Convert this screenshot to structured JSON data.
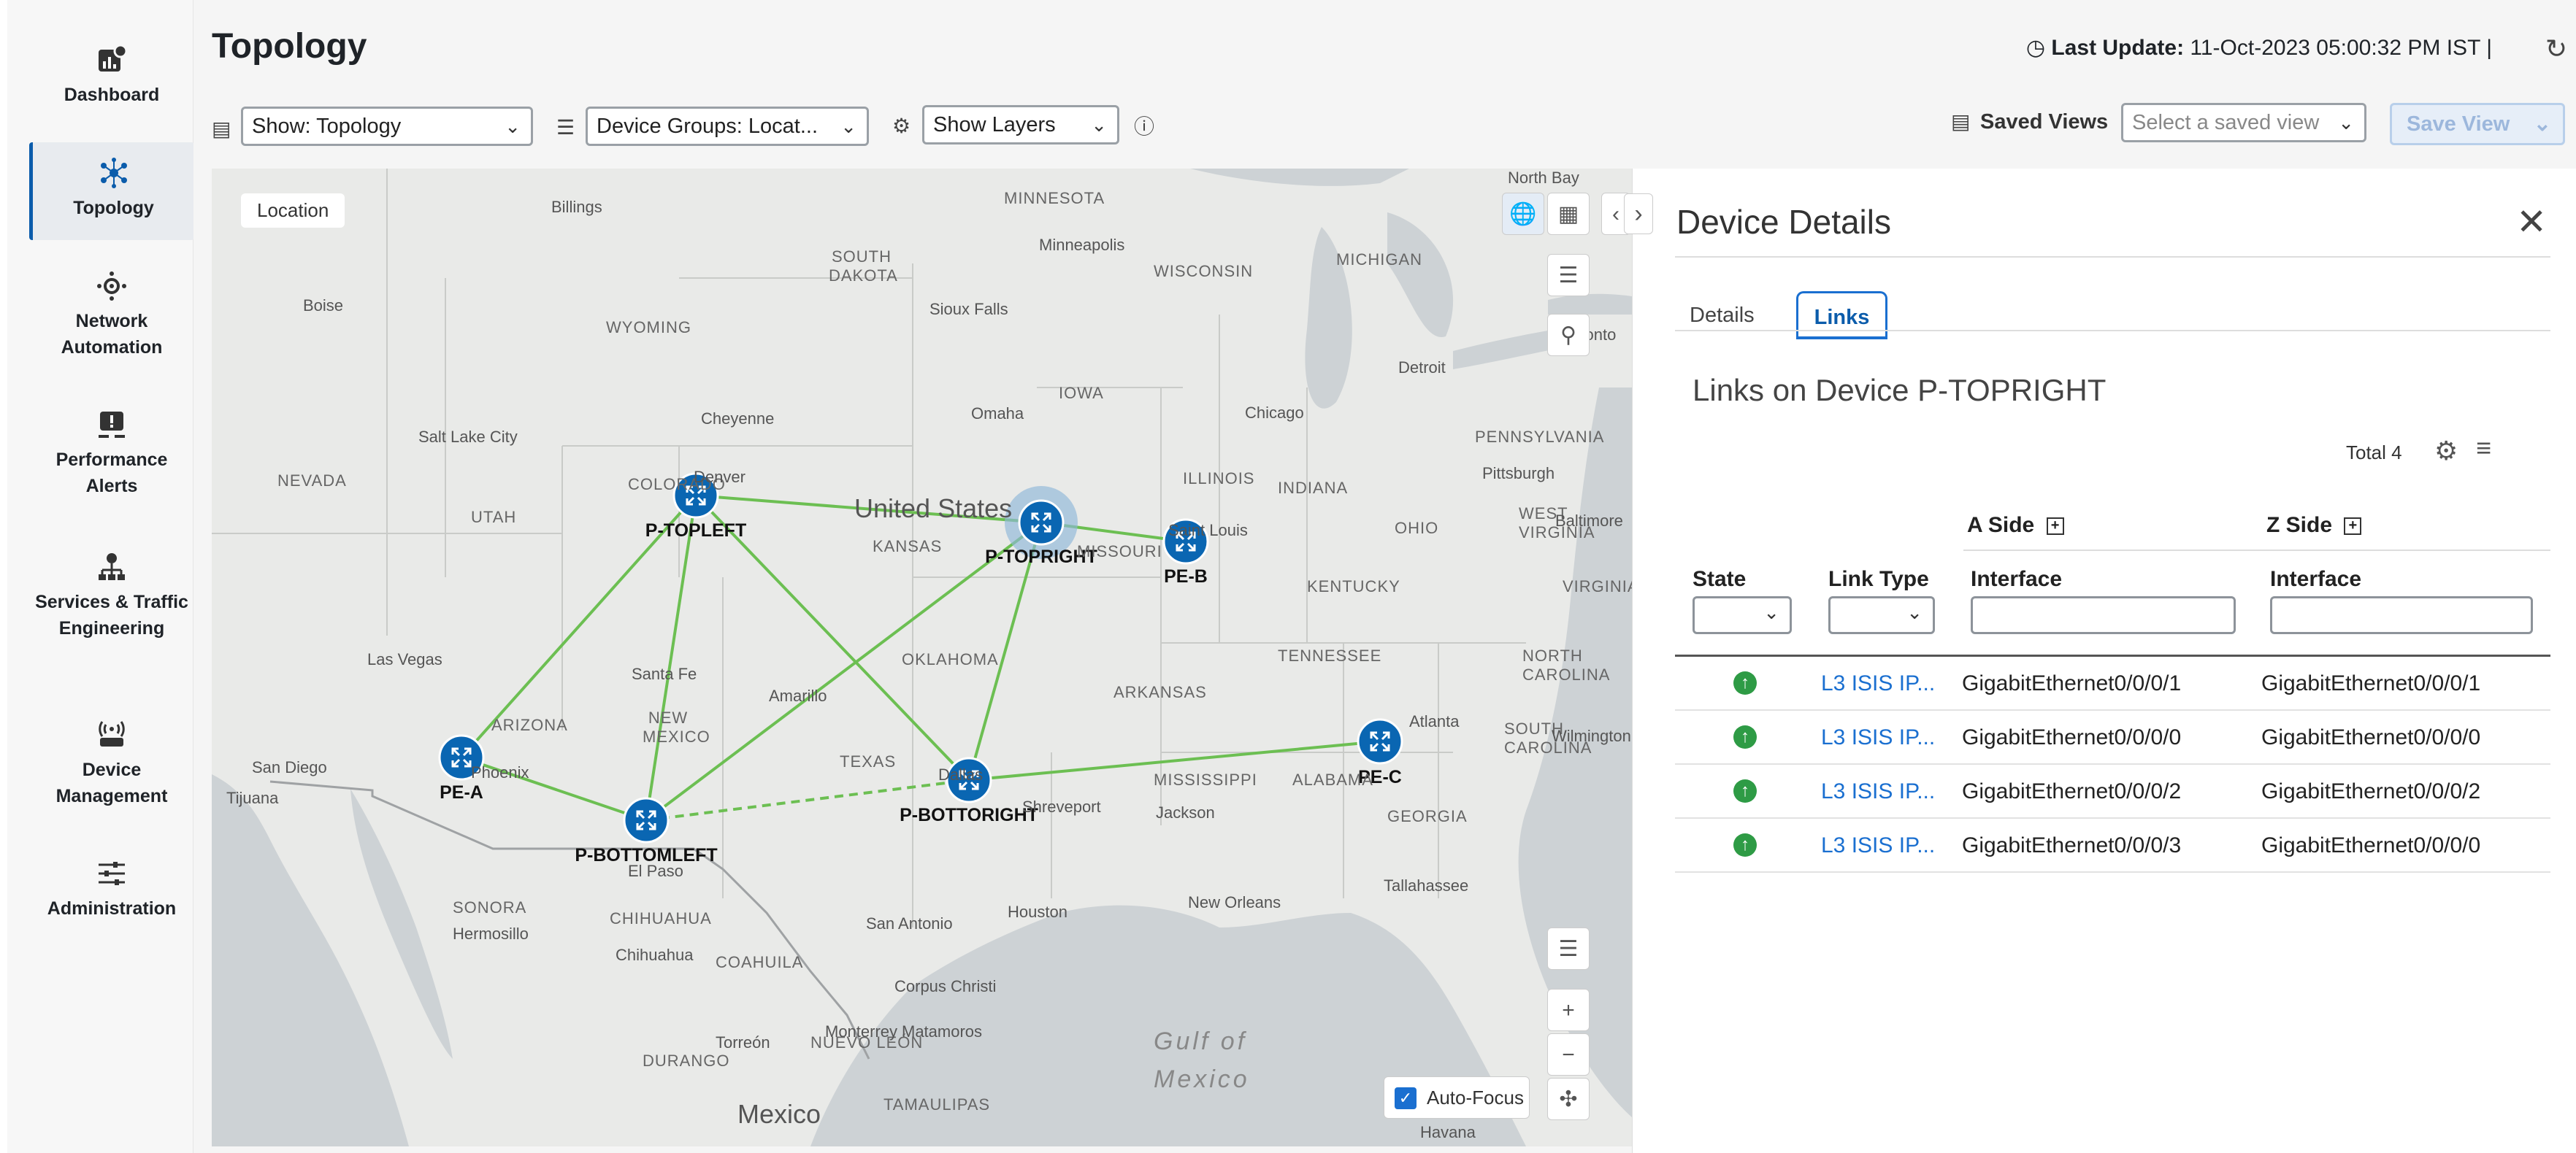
{
  "nav": [
    {
      "label": "Dashboard",
      "icon": "dashboard-icon"
    },
    {
      "label": "Topology",
      "icon": "topology-icon",
      "active": true
    },
    {
      "label": "Network Automation",
      "icon": "network-automation-icon"
    },
    {
      "label": "Performance Alerts",
      "icon": "alert-icon"
    },
    {
      "label": "Services & Traffic Engineering",
      "icon": "services-icon"
    },
    {
      "label": "Device Management",
      "icon": "device-icon"
    },
    {
      "label": "Administration",
      "icon": "sliders-icon"
    }
  ],
  "header": {
    "title": "Topology",
    "last_update_label": "Last Update:",
    "last_update_value": "11-Oct-2023 05:00:32 PM IST"
  },
  "toolbar": {
    "show": "Show: Topology",
    "device_groups": "Device Groups: Locat...",
    "layers": "Show Layers",
    "saved_views_label": "Saved Views",
    "saved_view_placeholder": "Select a saved view",
    "save_view": "Save View"
  },
  "map": {
    "location_tag": "Location",
    "auto_focus": "Auto-Focus",
    "country_label": "United States",
    "mexico_label": "Mexico",
    "gulf_label": "Gulf of Mexico",
    "nodes": [
      {
        "id": "P-TOPLEFT",
        "label": "P-TOPLEFT"
      },
      {
        "id": "P-TOPRIGHT",
        "label": "P-TOPRIGHT",
        "selected": true
      },
      {
        "id": "PE-B",
        "label": "PE-B"
      },
      {
        "id": "PE-A",
        "label": "PE-A"
      },
      {
        "id": "P-BOTTOMLEFT",
        "label": "P-BOTTOMLEFT"
      },
      {
        "id": "P-BOTTORIGHT",
        "label": "P-BOTTORIGHT"
      },
      {
        "id": "PE-C",
        "label": "PE-C"
      }
    ],
    "states": [
      "MINNESOTA",
      "SOUTH DAKOTA",
      "WISCONSIN",
      "MICHIGAN",
      "WYOMING",
      "IOWA",
      "NEVADA",
      "KANSAS",
      "ILLINOIS",
      "INDIANA",
      "PENNSYLVANIA",
      "OHIO",
      "KENTUCKY",
      "TENNESSEE",
      "OKLAHOMA",
      "ARKANSAS",
      "ARIZONA",
      "NEW MEXICO",
      "NORTH CAROLINA",
      "SOUTH CAROLINA",
      "MISSISSIPPI",
      "ALABAMA",
      "GEORGIA",
      "CHIHUAHUA",
      "COAHUILA",
      "SONORA",
      "TAMAULIPAS",
      "NUEVO LEÓN",
      "DURANGO",
      "UTAH",
      "COLORADO",
      "MISSOURI",
      "TEXAS",
      "WEST VIRGINIA",
      "VIRGINIA"
    ],
    "cities": [
      "North Bay",
      "Billings",
      "Minneapolis",
      "Boise",
      "Sioux Falls",
      "Detroit",
      "Toronto",
      "Cheyenne",
      "Omaha",
      "Chicago",
      "Salt Lake City",
      "Denver",
      "Pittsburgh",
      "Saint Louis",
      "Las Vegas",
      "Santa Fe",
      "Amarillo",
      "Phoenix",
      "San Diego",
      "Dallas",
      "Jackson",
      "Shreveport",
      "Atlanta",
      "Wilmington",
      "El Paso",
      "Hermosillo",
      "Chihuahua",
      "San Antonio",
      "Houston",
      "New Orleans",
      "Tallahassee",
      "Corpus Christi",
      "Monterrey",
      "Torreón",
      "Matamoros",
      "Havana",
      "Tijuana",
      "Baltimore"
    ]
  },
  "details": {
    "title": "Device Details",
    "tabs": [
      "Details",
      "Links"
    ],
    "active_tab": "Links",
    "heading": "Links on Device P-TOPRIGHT",
    "total": "Total 4",
    "a_side": "A Side",
    "z_side": "Z Side",
    "columns": [
      "State",
      "Link Type",
      "Interface",
      "Interface"
    ],
    "rows": [
      {
        "state": "up",
        "link_type": "L3 ISIS IP...",
        "a": "GigabitEthernet0/0/0/1",
        "z": "GigabitEthernet0/0/0/1"
      },
      {
        "state": "up",
        "link_type": "L3 ISIS IP...",
        "a": "GigabitEthernet0/0/0/0",
        "z": "GigabitEthernet0/0/0/0"
      },
      {
        "state": "up",
        "link_type": "L3 ISIS IP...",
        "a": "GigabitEthernet0/0/0/2",
        "z": "GigabitEthernet0/0/0/2"
      },
      {
        "state": "up",
        "link_type": "L3 ISIS IP...",
        "a": "GigabitEthernet0/0/0/3",
        "z": "GigabitEthernet0/0/0/0"
      }
    ]
  },
  "colors": {
    "link_green": "#6cbf52",
    "node_blue": "#0a66b2",
    "accent": "#1a6fd0",
    "state_up": "#2e9b45"
  }
}
